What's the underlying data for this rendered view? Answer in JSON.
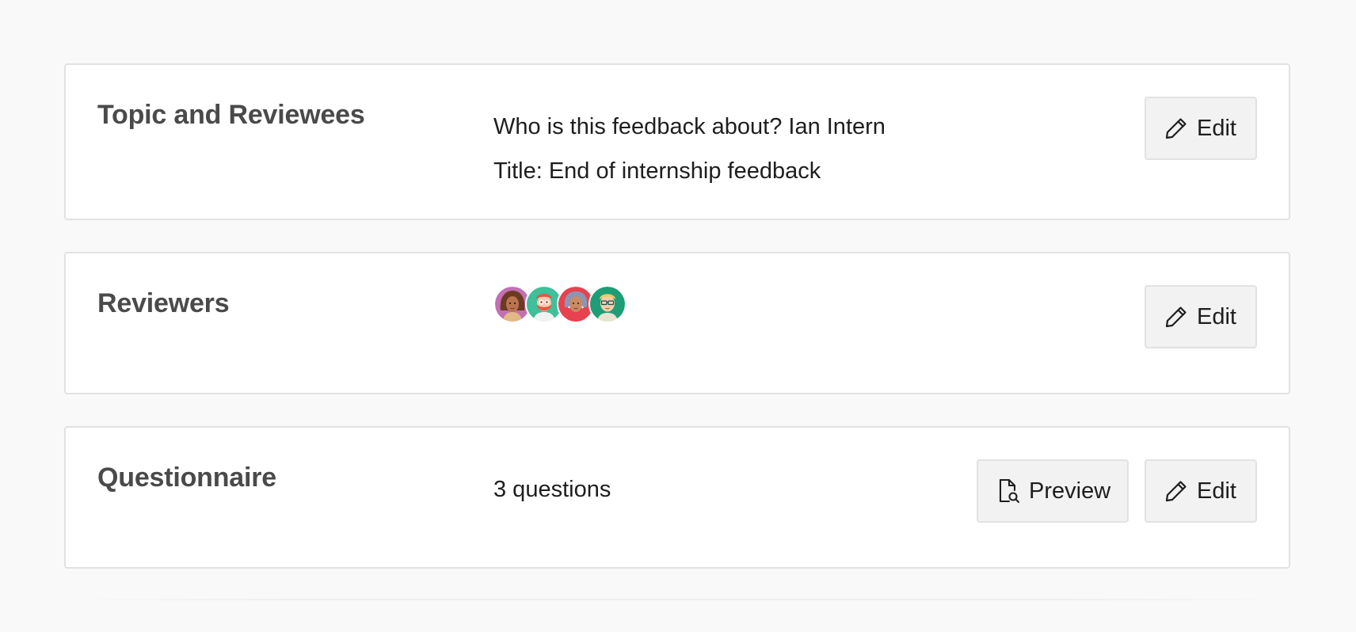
{
  "sections": {
    "topic": {
      "title": "Topic and Reviewees",
      "lines": [
        "Who is this feedback about? Ian Intern",
        "Title: End of internship feedback"
      ],
      "edit_label": "Edit"
    },
    "reviewers": {
      "title": "Reviewers",
      "avatars": [
        {
          "icon": "woman-curly-hair-avatar",
          "bg": "#c26fb3"
        },
        {
          "icon": "man-red-beard-avatar",
          "bg": "#3fbf9a"
        },
        {
          "icon": "woman-gray-hair-avatar",
          "bg": "#e8414f"
        },
        {
          "icon": "man-glasses-avatar",
          "bg": "#1d9e77"
        }
      ],
      "edit_label": "Edit"
    },
    "questionnaire": {
      "title": "Questionnaire",
      "summary": "3 questions",
      "preview_label": "Preview",
      "edit_label": "Edit"
    }
  },
  "icons": {
    "edit": "pencil-icon",
    "preview": "document-search-icon"
  },
  "colors": {
    "page_bg": "#f9f9f9",
    "card_bg": "#ffffff",
    "button_bg": "#f2f2f2",
    "border": "#e2e2e2",
    "title_text": "#4a4a4a"
  }
}
